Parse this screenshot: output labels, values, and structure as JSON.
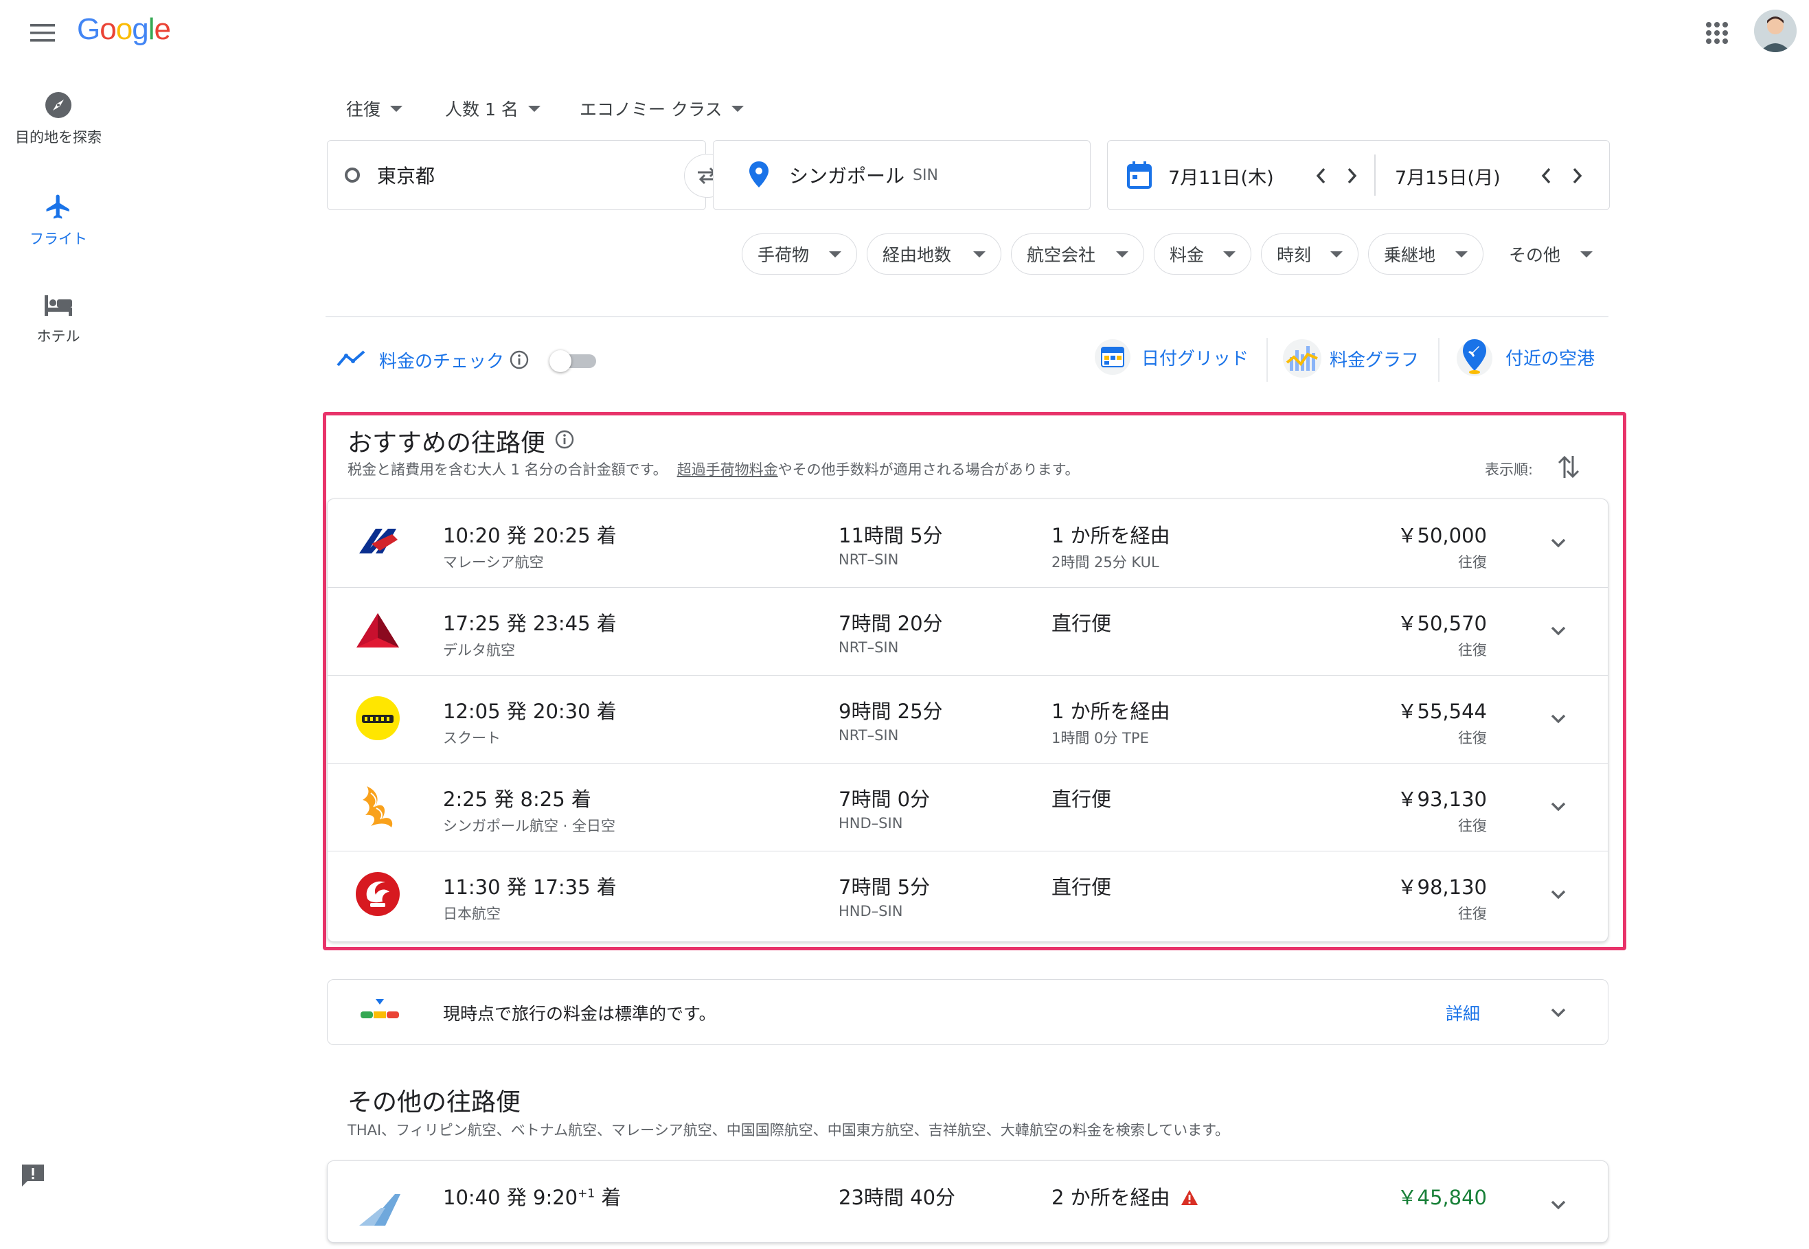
{
  "header": {
    "logo": "Google",
    "logo_colors": [
      "#4285F4",
      "#EA4335",
      "#FBBC05",
      "#4285F4",
      "#34A853",
      "#EA4335"
    ]
  },
  "sidebar": {
    "items": [
      {
        "label": "目的地を探索",
        "icon": "explore-icon",
        "active": false
      },
      {
        "label": "フライト",
        "icon": "flight-icon",
        "active": true
      },
      {
        "label": "ホテル",
        "icon": "hotel-icon",
        "active": false
      }
    ]
  },
  "search": {
    "trip_type": "往復",
    "passengers": "人数 1 名",
    "cabin_class": "エコノミー クラス",
    "origin": "東京都",
    "destination": "シンガポール",
    "destination_code": "SIN",
    "depart_date": "7月11日(木)",
    "return_date": "7月15日(月)"
  },
  "filters": [
    "手荷物",
    "経由地数",
    "航空会社",
    "料金",
    "時刻",
    "乗継地",
    "その他"
  ],
  "tools": {
    "price_tracking": "料金のチェック",
    "date_grid": "日付グリッド",
    "price_graph": "料金グラフ",
    "nearby_airports": "付近の空港"
  },
  "best_flights": {
    "title": "おすすめの往路便",
    "subtitle_pre": "税金と諸費用を含む大人 1 名分の合計金額です。",
    "subtitle_link": "超過手荷物料金",
    "subtitle_post": "やその他手数料が適用される場合があります。",
    "sort_label": "表示順:",
    "flights": [
      {
        "time": "10:20 発 20:25 着",
        "airline": "マレーシア航空",
        "duration": "11時間 5分",
        "route": "NRT–SIN",
        "stops": "1 か所を経由",
        "layover": "2時間 25分 KUL",
        "price": "￥50,000",
        "price_type": "往復",
        "logo": "malaysia-airlines-logo"
      },
      {
        "time": "17:25 発 23:45 着",
        "airline": "デルタ航空",
        "duration": "7時間 20分",
        "route": "NRT–SIN",
        "stops": "直行便",
        "layover": "",
        "price": "￥50,570",
        "price_type": "往復",
        "logo": "delta-logo"
      },
      {
        "time": "12:05 発 20:30 着",
        "airline": "スクート",
        "duration": "9時間 25分",
        "route": "NRT–SIN",
        "stops": "1 か所を経由",
        "layover": "1時間 0分 TPE",
        "price": "￥55,544",
        "price_type": "往復",
        "logo": "scoot-logo"
      },
      {
        "time": "2:25 発 8:25 着",
        "airline": "シンガポール航空 · 全日空",
        "duration": "7時間 0分",
        "route": "HND–SIN",
        "stops": "直行便",
        "layover": "",
        "price": "￥93,130",
        "price_type": "往復",
        "logo": "singapore-airlines-logo"
      },
      {
        "time": "11:30 発 17:35 着",
        "airline": "日本航空",
        "duration": "7時間 5分",
        "route": "HND–SIN",
        "stops": "直行便",
        "layover": "",
        "price": "￥98,130",
        "price_type": "往復",
        "logo": "jal-logo"
      }
    ]
  },
  "price_insight": {
    "text": "現時点で旅行の料金は標準的です。",
    "details": "詳細"
  },
  "other_flights": {
    "title": "その他の往路便",
    "subtitle": "THAI、フィリピン航空、ベトナム航空、マレーシア航空、中国国際航空、中国東方航空、吉祥航空、大韓航空の料金を検索しています。",
    "first": {
      "time": "10:40 発 9:20",
      "time_sup": "+1",
      "time_suffix": "着",
      "duration": "23時間 40分",
      "stops": "2 か所を経由",
      "price": "￥45,840",
      "price_color": "#188038"
    }
  },
  "colors": {
    "accent": "#1a73e8",
    "highlight_border": "#e8336a",
    "text": "#202124",
    "secondary": "#5f6368"
  }
}
